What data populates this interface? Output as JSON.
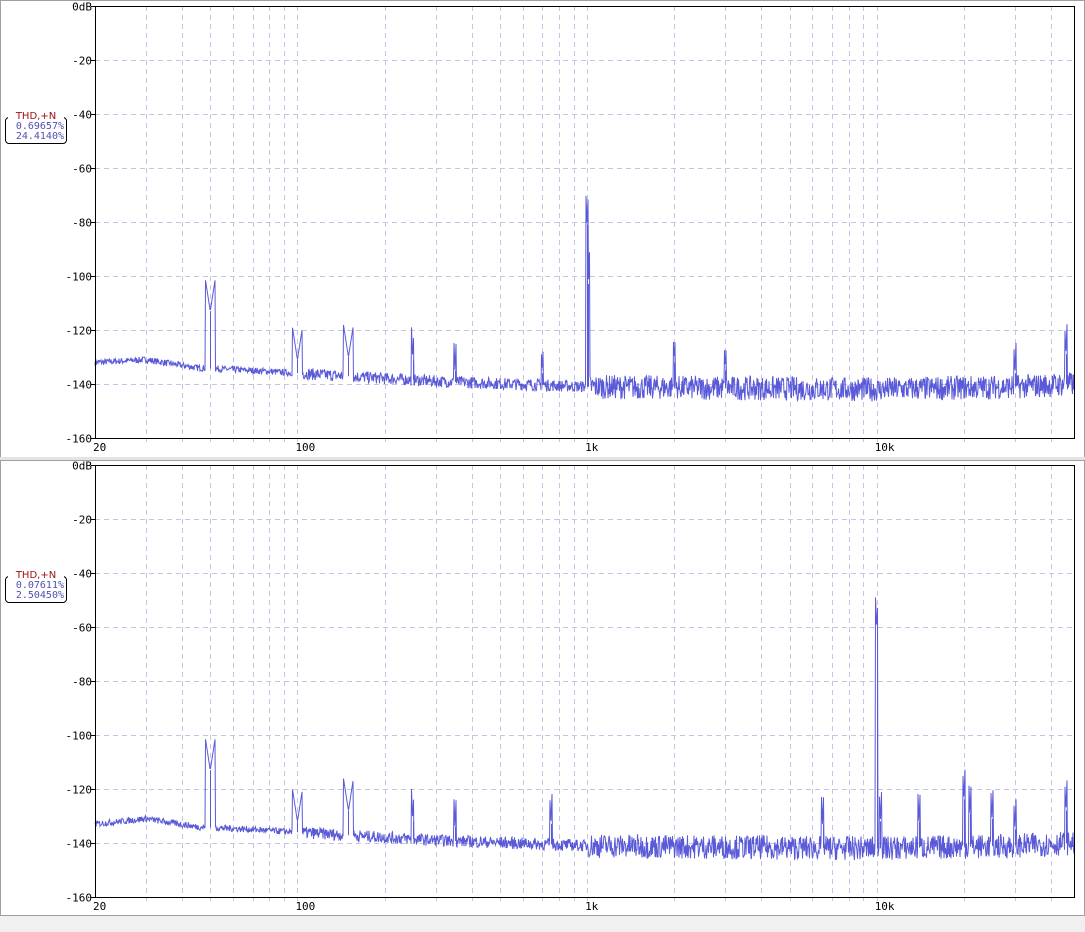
{
  "panels": [
    {
      "thd_label": "THD,+N",
      "thd_value": "0.69657%",
      "thdn_value": "24.4140%"
    },
    {
      "thd_label": "THD,+N",
      "thd_value": "0.07611%",
      "thdn_value": "2.50450%"
    }
  ],
  "colors": {
    "trace": "#5a5ad8",
    "grid": "#c4c4e4",
    "axis": "#000000"
  },
  "chart_data": [
    {
      "type": "line",
      "title": "",
      "xscale": "log",
      "xlim": [
        20,
        48000
      ],
      "ylim": [
        -160,
        0
      ],
      "grid": true,
      "y_ticks": [
        "0dB",
        "-20",
        "-40",
        "-60",
        "-80",
        "-100",
        "-120",
        "-140",
        "-160"
      ],
      "x_ticks": [
        {
          "value": 20,
          "label": "20"
        },
        {
          "value": 100,
          "label": "100"
        },
        {
          "value": 1000,
          "label": "1k"
        },
        {
          "value": 10000,
          "label": "10k"
        }
      ],
      "noise_floor": [
        [
          20,
          -132
        ],
        [
          30,
          -131
        ],
        [
          45,
          -134
        ],
        [
          70,
          -135
        ],
        [
          100,
          -136
        ],
        [
          300,
          -139
        ],
        [
          1000,
          -141
        ],
        [
          10000,
          -142
        ],
        [
          30000,
          -141
        ],
        [
          48000,
          -140
        ]
      ],
      "peaks": [
        [
          50,
          -113
        ],
        [
          100,
          -131
        ],
        [
          150,
          -130
        ],
        [
          250,
          -131
        ],
        [
          350,
          -135
        ],
        [
          700,
          -136
        ],
        [
          1000,
          -81
        ],
        [
          1010,
          -103
        ],
        [
          2000,
          -132
        ],
        [
          3000,
          -135
        ],
        [
          30000,
          -136
        ],
        [
          45000,
          -129
        ]
      ]
    },
    {
      "type": "line",
      "title": "",
      "xscale": "log",
      "xlim": [
        20,
        48000
      ],
      "ylim": [
        -160,
        0
      ],
      "grid": true,
      "y_ticks": [
        "0dB",
        "-20",
        "-40",
        "-60",
        "-80",
        "-100",
        "-120",
        "-140",
        "-160"
      ],
      "x_ticks": [
        {
          "value": 20,
          "label": "20"
        },
        {
          "value": 100,
          "label": "100"
        },
        {
          "value": 1000,
          "label": "1k"
        },
        {
          "value": 10000,
          "label": "10k"
        }
      ],
      "noise_floor": [
        [
          20,
          -133
        ],
        [
          30,
          -131
        ],
        [
          45,
          -134
        ],
        [
          70,
          -135
        ],
        [
          100,
          -136
        ],
        [
          300,
          -139
        ],
        [
          1000,
          -141
        ],
        [
          10000,
          -142
        ],
        [
          30000,
          -141
        ],
        [
          48000,
          -140
        ]
      ],
      "peaks": [
        [
          50,
          -113
        ],
        [
          100,
          -132
        ],
        [
          150,
          -128
        ],
        [
          250,
          -132
        ],
        [
          350,
          -134
        ],
        [
          750,
          -133
        ],
        [
          6500,
          -133
        ],
        [
          10000,
          -61
        ],
        [
          10300,
          -132
        ],
        [
          14000,
          -132
        ],
        [
          20000,
          -124
        ],
        [
          21000,
          -129
        ],
        [
          25000,
          -131
        ],
        [
          30000,
          -135
        ],
        [
          45000,
          -128
        ]
      ]
    }
  ]
}
